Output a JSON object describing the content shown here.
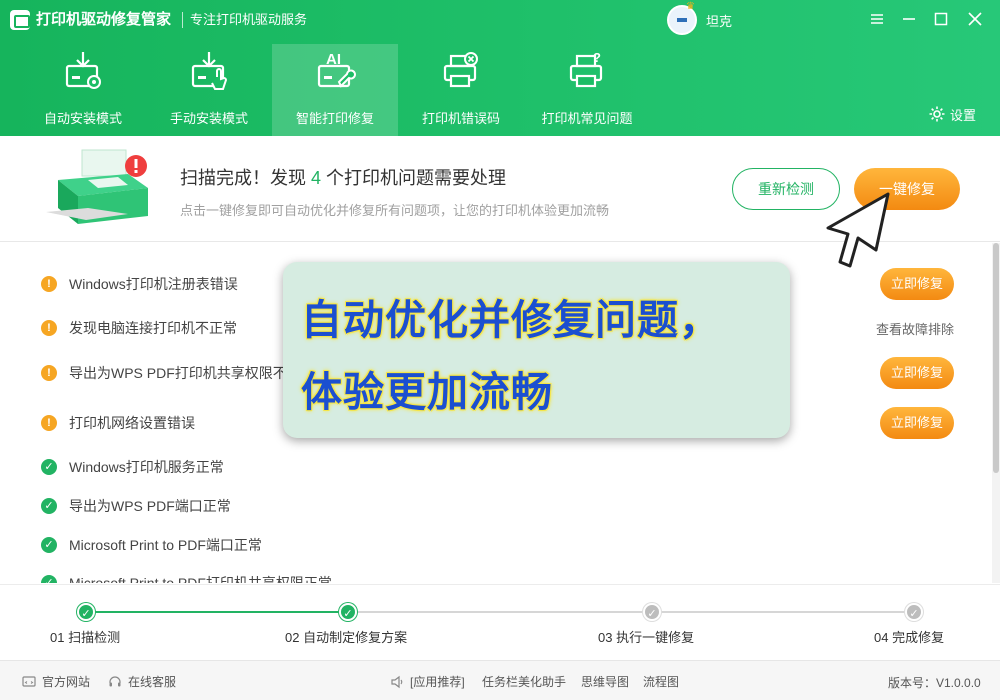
{
  "app": {
    "title": "打印机驱动修复管家",
    "subtitle": "专注打印机驱动服务",
    "username": "坦克"
  },
  "nav": [
    {
      "label": "自动安装模式",
      "icon": "auto-install-icon",
      "active": false
    },
    {
      "label": "手动安装模式",
      "icon": "manual-install-icon",
      "active": false
    },
    {
      "label": "智能打印修复",
      "icon": "ai-repair-icon",
      "active": true
    },
    {
      "label": "打印机错误码",
      "icon": "printer-error-icon",
      "active": false
    },
    {
      "label": "打印机常见问题",
      "icon": "printer-faq-icon",
      "active": false
    }
  ],
  "settings_label": "设置",
  "summary": {
    "title_prefix": "扫描完成！发现 ",
    "count": "4",
    "title_suffix": " 个打印机问题需要处理",
    "description": "点击一键修复即可自动优化并修复所有问题项，让您的打印机体验更加流畅",
    "rescan_label": "重新检测",
    "fixall_label": "一键修复"
  },
  "issues": [
    {
      "label": "Windows打印机注册表错误",
      "status": "warn",
      "action": "button",
      "action_label": "立即修复"
    },
    {
      "label": "发现电脑连接打印机不正常",
      "status": "warn",
      "action": "link",
      "action_label": "查看故障排除"
    },
    {
      "label": "导出为WPS PDF打印机共享权限不正",
      "status": "warn",
      "action": "button",
      "action_label": "立即修复"
    },
    {
      "label": "打印机网络设置错误",
      "status": "warn",
      "action": "button",
      "action_label": "立即修复"
    },
    {
      "label": "Windows打印机服务正常",
      "status": "ok",
      "action": "none",
      "action_label": ""
    },
    {
      "label": "导出为WPS PDF端口正常",
      "status": "ok",
      "action": "none",
      "action_label": ""
    },
    {
      "label": "Microsoft Print to PDF端口正常",
      "status": "ok",
      "action": "none",
      "action_label": ""
    },
    {
      "label": "Microsoft Print to PDF打印机共享权限正常",
      "status": "ok",
      "action": "none",
      "action_label": ""
    }
  ],
  "overlay": {
    "line1": "自动优化并修复问题，",
    "line2": "体验更加流畅"
  },
  "steps": [
    {
      "label": "01 扫描检测",
      "done": true
    },
    {
      "label": "02 自动制定修复方案",
      "done": true
    },
    {
      "label": "03 执行一键修复",
      "done": false
    },
    {
      "label": "04 完成修复",
      "done": false
    }
  ],
  "footer": {
    "website": "官方网站",
    "support": "在线客服",
    "recommend": "[应用推荐]",
    "app1": "任务栏美化助手",
    "app2": "思维导图",
    "app3": "流程图",
    "version": "版本号：V1.0.0.0"
  },
  "colors": {
    "brand_green": "#22b363",
    "warn_orange": "#f6a623",
    "overlay_text": "#1b4fd0",
    "overlay_glow": "#f5e64a"
  }
}
